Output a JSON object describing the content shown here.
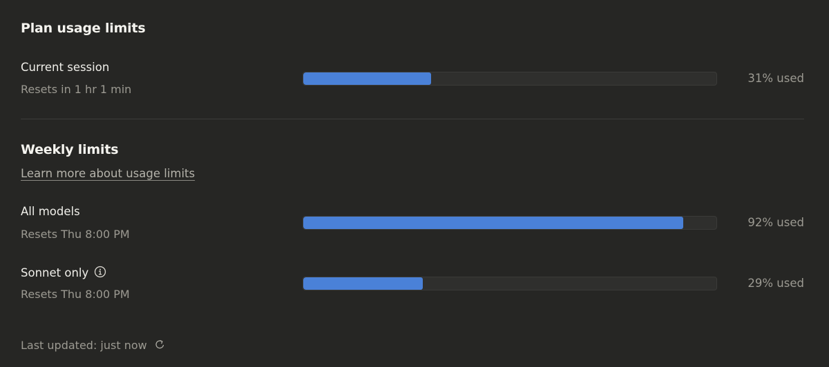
{
  "plan": {
    "title": "Plan usage limits",
    "current_session": {
      "label": "Current session",
      "reset": "Resets in 1 hr 1 min",
      "percent": 31,
      "percent_label": "31% used"
    }
  },
  "weekly": {
    "title": "Weekly limits",
    "learn_more": "Learn more about usage limits",
    "items": [
      {
        "label": "All models",
        "reset": "Resets Thu 8:00 PM",
        "percent": 92,
        "percent_label": "92% used"
      },
      {
        "label": "Sonnet only",
        "reset": "Resets Thu 8:00 PM",
        "percent": 29,
        "percent_label": "29% used",
        "icon": "info-icon"
      }
    ]
  },
  "footer": {
    "last_updated": "Last updated: just now",
    "icon": "refresh-icon"
  },
  "colors": {
    "background": "#262624",
    "bar_fill": "#4a81d8",
    "bar_track": "#2f2f2d",
    "muted_text": "#9c9a92"
  }
}
